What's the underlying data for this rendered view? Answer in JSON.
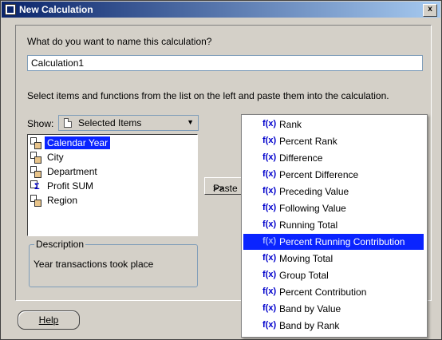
{
  "window": {
    "title": "New Calculation",
    "close_label": "x"
  },
  "name_prompt": "What do you want to name this calculation?",
  "name_value": "Calculation1",
  "instructions": "Select items and functions from the list on the left and paste them into the calculation.",
  "show": {
    "label": "Show:",
    "value": "Selected Items"
  },
  "items": [
    {
      "label": "Calendar Year",
      "icon": "dimension-icon",
      "selected": true
    },
    {
      "label": "City",
      "icon": "dimension-icon",
      "selected": false
    },
    {
      "label": "Department",
      "icon": "dimension-icon",
      "selected": false
    },
    {
      "label": "Profit SUM",
      "icon": "measure-sum-icon",
      "selected": false
    },
    {
      "label": "Region",
      "icon": "dimension-icon",
      "selected": false
    }
  ],
  "description": {
    "legend": "Description",
    "text": "Year transactions took place"
  },
  "paste_label": "Paste",
  "paste_arrow": ">>",
  "help_label": "Help",
  "functions": [
    {
      "icon_text": "f(x)",
      "label": "Rank",
      "selected": false
    },
    {
      "icon_text": "f(x)",
      "label": "Percent Rank",
      "selected": false
    },
    {
      "icon_text": "f(x)",
      "label": "Difference",
      "selected": false
    },
    {
      "icon_text": "f(x)",
      "label": "Percent Difference",
      "selected": false
    },
    {
      "icon_text": "f(x)",
      "label": "Preceding Value",
      "selected": false
    },
    {
      "icon_text": "f(x)",
      "label": "Following Value",
      "selected": false
    },
    {
      "icon_text": "f(x)",
      "label": "Running Total",
      "selected": false
    },
    {
      "icon_text": "f(x)",
      "label": "Percent Running Contribution",
      "selected": true
    },
    {
      "icon_text": "f(x)",
      "label": "Moving Total",
      "selected": false
    },
    {
      "icon_text": "f(x)",
      "label": "Group Total",
      "selected": false
    },
    {
      "icon_text": "f(x)",
      "label": "Percent Contribution",
      "selected": false
    },
    {
      "icon_text": "f(x)",
      "label": "Band by Value",
      "selected": false
    },
    {
      "icon_text": "f(x)",
      "label": "Band by Rank",
      "selected": false
    }
  ],
  "colors": {
    "titlebar": "#0a246a",
    "selection": "#0a24ff",
    "fx": "#0000cc"
  }
}
